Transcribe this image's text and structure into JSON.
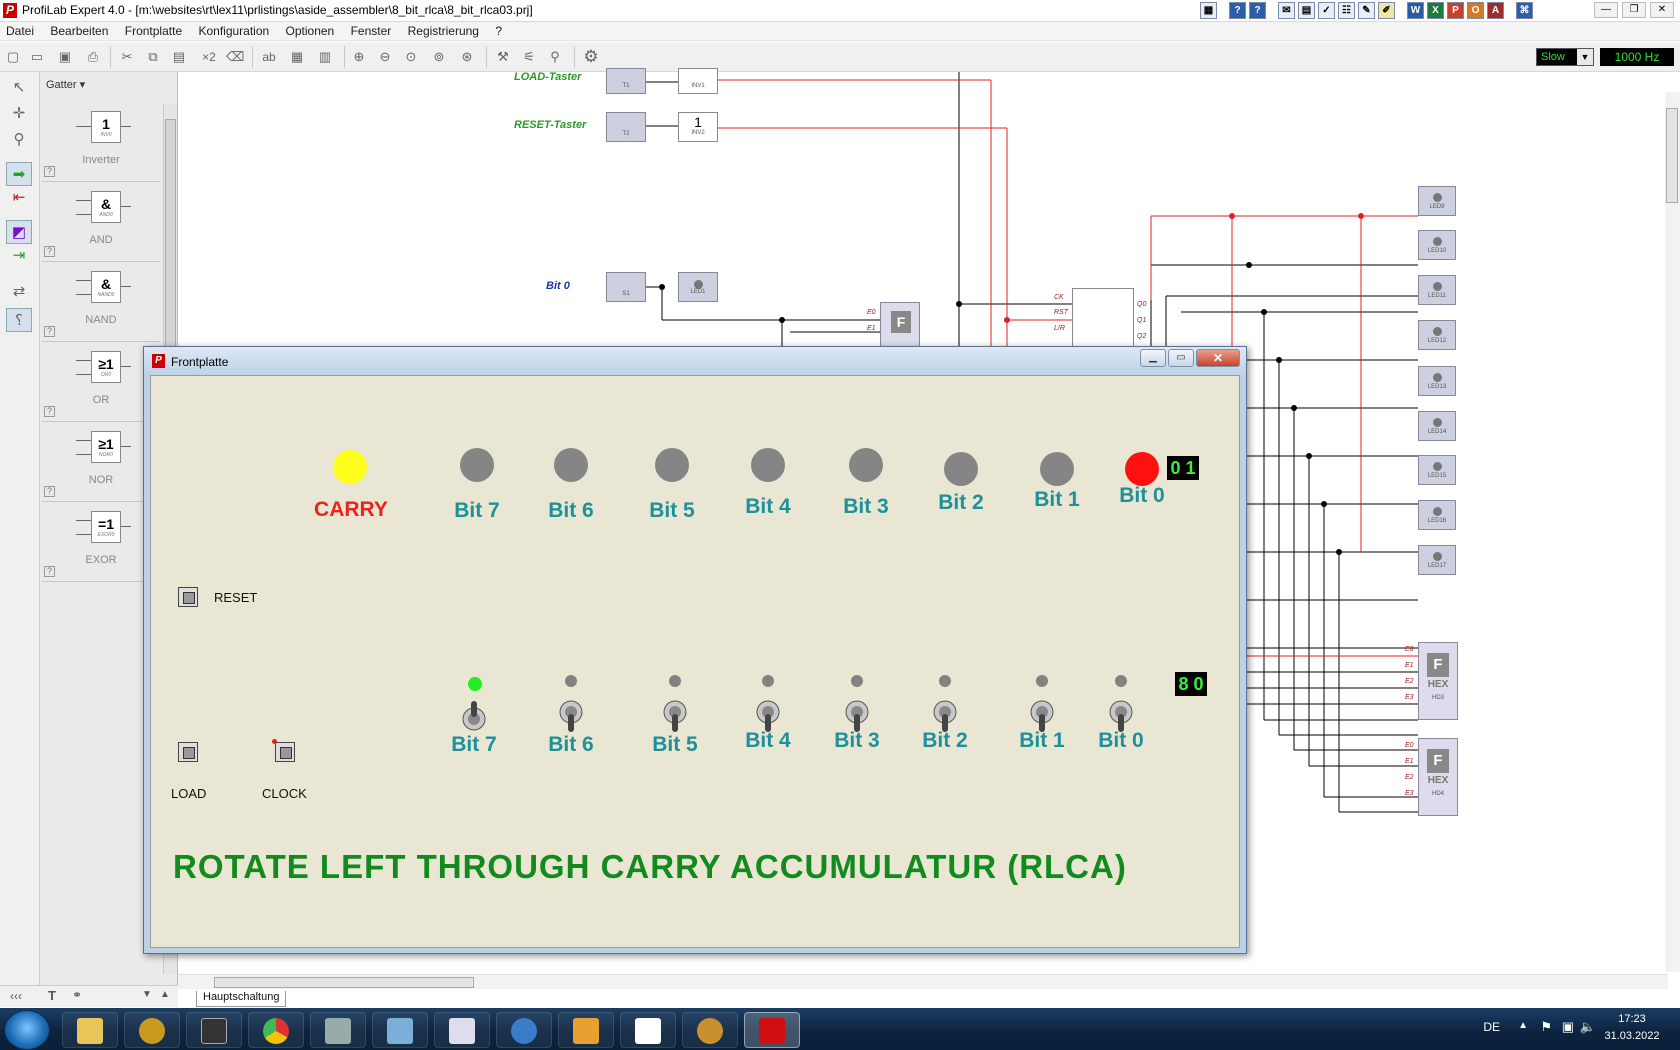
{
  "window": {
    "title": "ProfiLab Expert 4.0 - [m:\\websites\\rt\\lex11\\prlistings\\aside_assembler\\8_bit_rlca\\8_bit_rlca03.prj]"
  },
  "menu": [
    "Datei",
    "Bearbeiten",
    "Frontplatte",
    "Konfiguration",
    "Optionen",
    "Fenster",
    "Registrierung",
    "?"
  ],
  "toolbar": {
    "speed_value": "Slow",
    "frequency_value": "1000 Hz"
  },
  "palette": {
    "category": "Gatter",
    "gates": [
      {
        "symbol": "1",
        "small": "INV0",
        "name": "Inverter"
      },
      {
        "symbol": "&",
        "small": "AND0",
        "name": "AND"
      },
      {
        "symbol": "&",
        "small": "NAND0",
        "name": "NAND"
      },
      {
        "symbol": "≥1",
        "small": "OR0",
        "name": "OR"
      },
      {
        "symbol": "≥1",
        "small": "NOR0",
        "name": "NOR"
      },
      {
        "symbol": "=1",
        "small": "EXOR0",
        "name": "EXOR"
      }
    ],
    "help_mark": "?"
  },
  "schematic": {
    "labels": {
      "load": "LOAD-Taster",
      "reset": "RESET-Taster",
      "bit0": "Bit 0"
    },
    "components": {
      "t1": "T1",
      "t2": "T2",
      "inv1": "INV1",
      "inv2": "INV2",
      "s1": "S1",
      "led1": "LED1",
      "f": "F",
      "e0": "E0",
      "e1": "E1",
      "ck": "CK",
      "rst": "RST",
      "lr": "L/R",
      "q0": "Q0",
      "q1": "Q1",
      "q2": "Q2",
      "hex": "HEX",
      "hex3": "HD3",
      "hex4": "HD4",
      "leds": [
        "LED9",
        "LED10",
        "LED11",
        "LED12",
        "LED13",
        "LED14",
        "LED15",
        "LED16",
        "LED17"
      ],
      "hexinputs": [
        "E0",
        "E1",
        "E2",
        "E3"
      ],
      "inv_symbol": "1"
    },
    "tab": "Hauptschaltung"
  },
  "frontpanel": {
    "title": "Frontplatte",
    "carry_label": "CARRY",
    "bits_top": [
      "Bit 7",
      "Bit 6",
      "Bit 5",
      "Bit 4",
      "Bit 3",
      "Bit 2",
      "Bit 1",
      "Bit 0"
    ],
    "bits_bottom": [
      "Bit 7",
      "Bit 6",
      "Bit 5",
      "Bit 4",
      "Bit 3",
      "Bit 2",
      "Bit 1",
      "Bit 0"
    ],
    "top_led_states": [
      0,
      0,
      0,
      0,
      0,
      0,
      0,
      1
    ],
    "bottom_led_states": [
      1,
      0,
      0,
      0,
      0,
      0,
      0,
      0
    ],
    "display_top": [
      "0",
      "1"
    ],
    "display_bottom": [
      "8",
      "0"
    ],
    "reset_label": "RESET",
    "load_label": "LOAD",
    "clock_label": "CLOCK",
    "heading": "ROTATE LEFT THROUGH CARRY ACCUMULATUR (RLCA)",
    "colors": {
      "carry": "#ffff1e",
      "led_on": "#ff1010",
      "led_off": "#858585",
      "small_led_on": "#22ee22",
      "heading": "#138a1e",
      "bit_label": "#1e9099",
      "carry_label": "#ee2020"
    }
  },
  "taskbar": {
    "language": "DE",
    "time": "17:23",
    "date": "31.03.2022"
  }
}
